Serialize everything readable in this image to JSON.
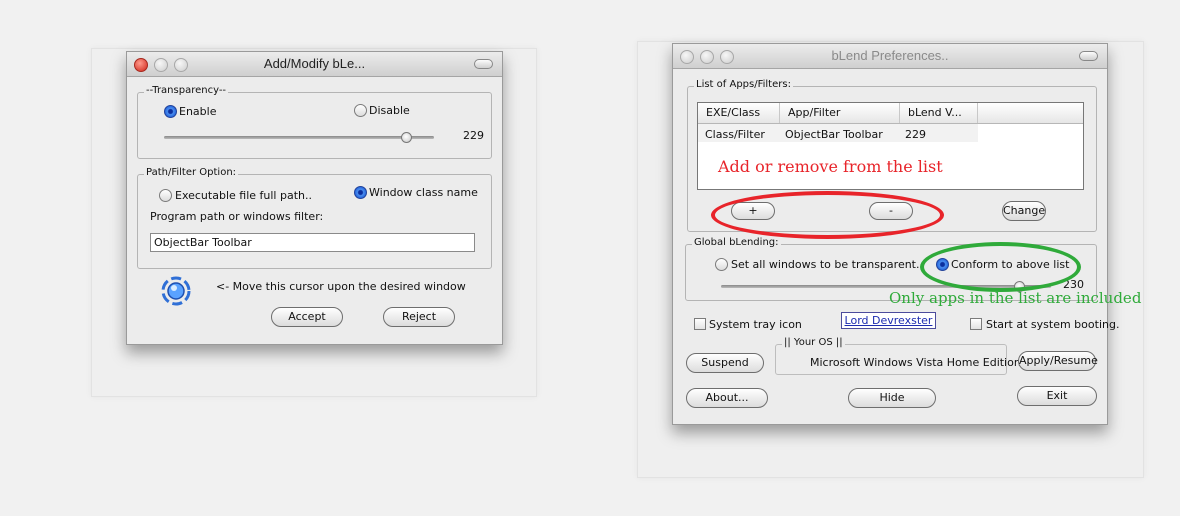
{
  "add_dialog": {
    "title": "Add/Modify bLe...",
    "transparency": {
      "legend": "--Transparency--",
      "enable_label": "Enable",
      "disable_label": "Disable",
      "selected": "enable",
      "value": "229",
      "slider_value": 229,
      "slider_max": 255
    },
    "path_filter": {
      "legend": "Path/Filter Option:",
      "exec_label": "Executable file full path..",
      "class_label": "Window class name",
      "selected": "class",
      "field_label": "Program path or windows filter:",
      "field_value": "ObjectBar Toolbar"
    },
    "cursor_hint": "<- Move this cursor upon the desired window",
    "cursor_icon": "target-cursor-icon",
    "accept_label": "Accept",
    "reject_label": "Reject"
  },
  "prefs_dialog": {
    "title": "bLend Preferences..",
    "apps_group": {
      "legend": "List of Apps/Filters:",
      "columns": [
        "EXE/Class",
        "App/Filter",
        "bLend V..."
      ],
      "rows": [
        [
          "Class/Filter",
          "ObjectBar Toolbar",
          "229"
        ]
      ]
    },
    "add_label": "+",
    "remove_label": "-",
    "change_label": "Change",
    "global": {
      "legend": "Global bLending:",
      "all_label": "Set all windows to be transparent.",
      "conform_label": "Conform to above list",
      "selected": "conform",
      "value": "230",
      "slider_value": 230,
      "slider_max": 255
    },
    "tray_label": "System tray icon",
    "tray_checked": false,
    "author_link": "Lord Devrexster",
    "startup_label": "Start at system booting.",
    "startup_checked": false,
    "os_legend": "|| Your OS ||",
    "os_value": "Microsoft Windows Vista Home Edition",
    "suspend_label": "Suspend",
    "apply_label": "Apply/Resume",
    "about_label": "About...",
    "hide_label": "Hide",
    "exit_label": "Exit"
  },
  "annotations": {
    "list_note": "Add or remove from the list",
    "list_note_color": "#e8242a",
    "conform_note": "Only apps in the list are included",
    "conform_note_color": "#2faa3a"
  }
}
